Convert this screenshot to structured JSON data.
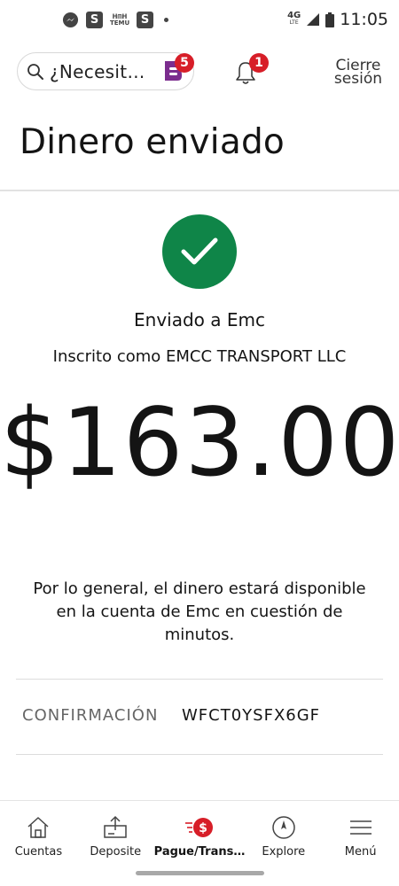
{
  "status_bar": {
    "time": "11:05",
    "network": "4G",
    "network_sub": "LTE",
    "left_icons": [
      "messenger-icon",
      "s-app-icon",
      "temu-icon",
      "s-app-icon",
      "dot-icon"
    ],
    "temu_label_top": "ᕼᗰᕼ",
    "temu_label": "TEMU",
    "s_label": "S"
  },
  "header": {
    "search_placeholder": "¿Necesit…",
    "fargo_badge": "5",
    "notification_badge": "1",
    "signout_line1": "Cierre",
    "signout_line2": "sesión"
  },
  "page": {
    "title": "Dinero enviado",
    "sent_to": "Enviado a Emc",
    "enrolled_as": "Inscrito como EMCC TRANSPORT LLC",
    "amount": "$163.00",
    "availability_note": "Por lo general, el dinero estará disponible en la cuenta de Emc en cuestión de minutos.",
    "confirmation_label": "CONFIRMACIÓN",
    "confirmation_value": "WFCT0YSFX6GF"
  },
  "tabbar": {
    "tabs": [
      {
        "label": "Cuentas",
        "icon": "home-icon"
      },
      {
        "label": "Deposite",
        "icon": "deposit-icon"
      },
      {
        "label": "Pague/Trans…",
        "icon": "pay-transfer-icon",
        "active": true
      },
      {
        "label": "Explore",
        "icon": "compass-icon"
      },
      {
        "label": "Menú",
        "icon": "menu-icon"
      }
    ]
  },
  "colors": {
    "brand_red": "#d71e28",
    "success_green": "#0f8548",
    "fargo_purple": "#7b2d8e"
  }
}
